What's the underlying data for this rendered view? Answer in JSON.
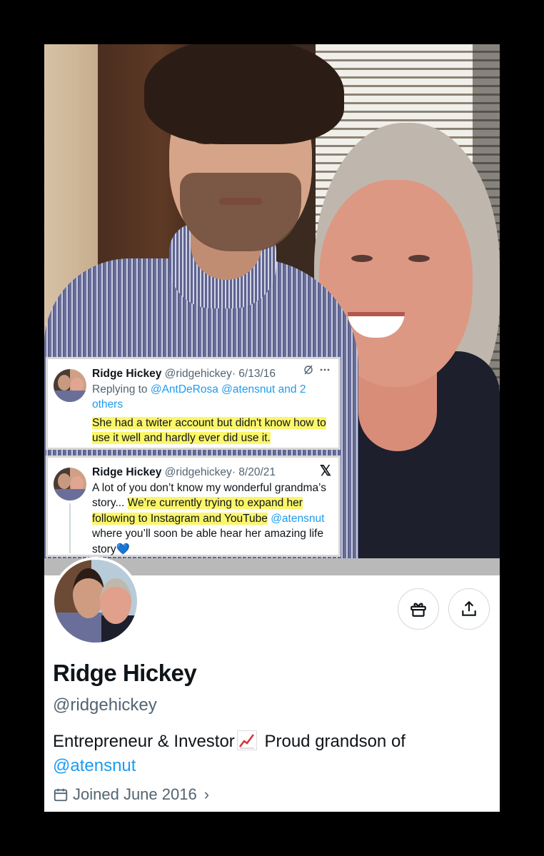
{
  "tweets": [
    {
      "name": "Ridge Hickey",
      "handle": "@ridgehickey",
      "date": "· 6/13/16",
      "icon": "sync-icon",
      "replying_prefix": "Replying to ",
      "replying_mentions": "@AntDeRosa @atensnut and 2 others",
      "text_highlighted": "She had a twiter account but didn't know how to use it well and hardly ever did use it."
    },
    {
      "name": "Ridge Hickey",
      "handle": "@ridgehickey",
      "date": "· 8/20/21",
      "icon": "x-logo",
      "text_plain": "A lot of you don’t know my wonderful grandma’s story... ",
      "text_highlighted": "We’re currently trying to expand her following to Instagram and YouTube",
      "mention": "@atensnut",
      "text_end": " where you’ll soon be able hear her amazing life story💙"
    }
  ],
  "profile": {
    "name": "Ridge Hickey",
    "handle": "@ridgehickey",
    "bio_text": "Entrepreneur & Investor",
    "bio_text2": " Proud grandson of",
    "bio_mention": "@atensnut",
    "joined": "Joined June 2016",
    "gift_icon": "gift-icon",
    "share_icon": "share-icon",
    "calendar_icon": "calendar-icon",
    "emoji": "chart-increasing-emoji"
  },
  "colors": {
    "link": "#1d9bf0",
    "highlight": "#fbf66a",
    "muted": "#536471"
  }
}
